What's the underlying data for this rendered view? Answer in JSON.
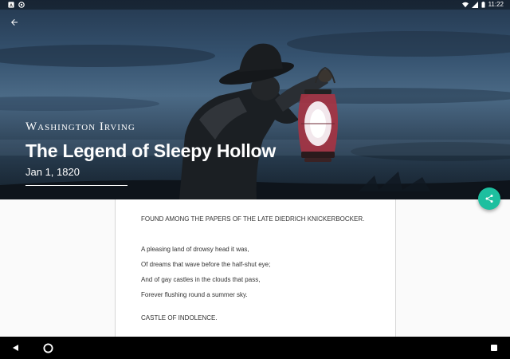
{
  "status_bar": {
    "time": "11:22",
    "left_icons": [
      "notification-a-icon",
      "sync-icon"
    ],
    "right_icons": [
      "wifi-icon",
      "signal-icon",
      "battery-icon"
    ]
  },
  "hero": {
    "author": "Washington Irving",
    "title": "The Legend of Sleepy Hollow",
    "date": "Jan 1, 1820",
    "back_icon": "arrow-back-icon",
    "share_icon": "share-icon",
    "colors": {
      "fab": "#1dbf9f"
    }
  },
  "content": {
    "lines": [
      "FOUND AMONG THE PAPERS OF THE LATE DIEDRICH KNICKERBOCKER.",
      "A pleasing land of drowsy head it was,",
      "Of dreams that wave before the half-shut eye;",
      "And of gay castles in the clouds that pass,",
      "Forever flushing round a summer sky.",
      "CASTLE OF INDOLENCE."
    ]
  },
  "nav_bar": {
    "buttons": [
      "back-triangle-icon",
      "home-circle-icon",
      "recents-square-icon"
    ]
  }
}
